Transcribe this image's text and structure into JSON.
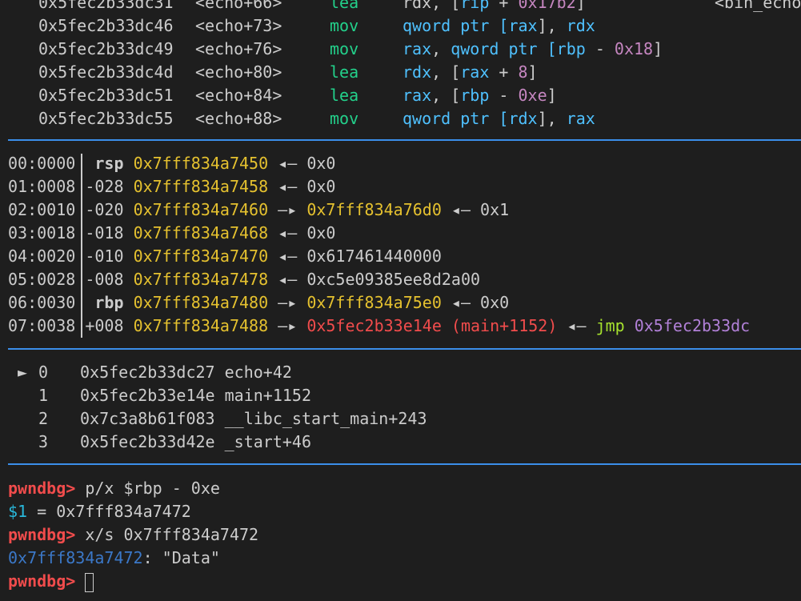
{
  "disasm": [
    {
      "addr": "0x5fec2b33dc31",
      "sym": "<echo+66>",
      "mnem": "lea",
      "ops": [
        [
          "rdx, [",
          ""
        ],
        [
          "rip",
          "blue"
        ],
        [
          " + ",
          ""
        ],
        [
          "0x17b2",
          "purple"
        ],
        [
          "]",
          ""
        ]
      ],
      "comment": "<bin_echo"
    },
    {
      "addr": "0x5fec2b33dc46",
      "sym": "<echo+73>",
      "mnem": "mov",
      "ops": [
        [
          "qword ptr [",
          "blue"
        ],
        [
          "rax",
          "blue"
        ],
        [
          "], ",
          ""
        ],
        [
          "rdx",
          "blue"
        ]
      ]
    },
    {
      "addr": "0x5fec2b33dc49",
      "sym": "<echo+76>",
      "mnem": "mov",
      "ops": [
        [
          "rax",
          "blue"
        ],
        [
          ", ",
          ""
        ],
        [
          "qword ptr [",
          "blue"
        ],
        [
          "rbp",
          "blue"
        ],
        [
          " - ",
          ""
        ],
        [
          "0x18",
          "purple"
        ],
        [
          "]",
          ""
        ]
      ]
    },
    {
      "addr": "0x5fec2b33dc4d",
      "sym": "<echo+80>",
      "mnem": "lea",
      "ops": [
        [
          "rdx",
          "blue"
        ],
        [
          ", [",
          ""
        ],
        [
          "rax",
          "blue"
        ],
        [
          " + ",
          ""
        ],
        [
          "8",
          "purple"
        ],
        [
          "]",
          ""
        ]
      ]
    },
    {
      "addr": "0x5fec2b33dc51",
      "sym": "<echo+84>",
      "mnem": "lea",
      "ops": [
        [
          "rax",
          "blue"
        ],
        [
          ", [",
          ""
        ],
        [
          "rbp",
          "blue"
        ],
        [
          " - ",
          ""
        ],
        [
          "0xe",
          "purple"
        ],
        [
          "]",
          ""
        ]
      ]
    },
    {
      "addr": "0x5fec2b33dc55",
      "sym": "<echo+88>",
      "mnem": "mov",
      "ops": [
        [
          "qword ptr [",
          "blue"
        ],
        [
          "rdx",
          "blue"
        ],
        [
          "], ",
          ""
        ],
        [
          "rax",
          "blue"
        ]
      ]
    }
  ],
  "stack": [
    {
      "idx": "00:0000",
      "off": " rsp",
      "off_bold": true,
      "addr": "0x7fff834a7450",
      "arrow": "◂—",
      "val": "0x0"
    },
    {
      "idx": "01:0008",
      "off": "-028",
      "off_bold": false,
      "addr": "0x7fff834a7458",
      "arrow": "◂—",
      "val": "0x0"
    },
    {
      "idx": "02:0010",
      "off": "-020",
      "off_bold": false,
      "addr": "0x7fff834a7460",
      "arrow": "—▸",
      "val": "0x7fff834a76d0",
      "val_color": "yellow",
      "tail": " ◂— 0x1"
    },
    {
      "idx": "03:0018",
      "off": "-018",
      "off_bold": false,
      "addr": "0x7fff834a7468",
      "arrow": "◂—",
      "val": "0x0"
    },
    {
      "idx": "04:0020",
      "off": "-010",
      "off_bold": false,
      "addr": "0x7fff834a7470",
      "arrow": "◂—",
      "val": "0x617461440000"
    },
    {
      "idx": "05:0028",
      "off": "-008",
      "off_bold": false,
      "addr": "0x7fff834a7478",
      "arrow": "◂—",
      "val": "0xc5e09385ee8d2a00"
    },
    {
      "idx": "06:0030",
      "off": " rbp",
      "off_bold": true,
      "addr": "0x7fff834a7480",
      "arrow": "—▸",
      "val": "0x7fff834a75e0",
      "val_color": "yellow",
      "tail": " ◂— 0x0"
    },
    {
      "idx": "07:0038",
      "off": "+008",
      "off_bold": false,
      "addr": "0x7fff834a7488",
      "arrow": "—▸",
      "val": "0x5fec2b33e14e (main+1152)",
      "val_color": "red",
      "tail2": [
        " ◂— ",
        [
          "jmp",
          "lime"
        ],
        [
          " 0x5fec2b33dc",
          "violet"
        ]
      ]
    }
  ],
  "backtrace": [
    {
      "marker": "►",
      "n": "0",
      "addr": "0x5fec2b33dc27",
      "sym": "echo+42"
    },
    {
      "marker": "",
      "n": "1",
      "addr": "0x5fec2b33e14e",
      "sym": "main+1152"
    },
    {
      "marker": "",
      "n": "2",
      "addr": "0x7c3a8b61f083",
      "sym": "__libc_start_main+243"
    },
    {
      "marker": "",
      "n": "3",
      "addr": "0x5fec2b33d42e",
      "sym": "_start+46"
    }
  ],
  "console": {
    "prompt": "pwndbg>",
    "cmd1": " p/x $rbp - 0xe",
    "res1_var": "$1",
    "res1_rest": " = 0x7fff834a7472",
    "cmd2": " x/s 0x7fff834a7472",
    "res2_addr": "0x7fff834a7472",
    "res2_rest": ": \"Data\""
  },
  "colors": {
    "background": "#1e1e1e",
    "text": "#cccccc",
    "mnemonic": "#23d18b",
    "register": "#4fc1ff",
    "number": "#c586c0",
    "stack_addr": "#e5c12f",
    "code_addr": "#f14c4c",
    "separator": "#3b8eea",
    "prompt": "#f14c4c"
  }
}
